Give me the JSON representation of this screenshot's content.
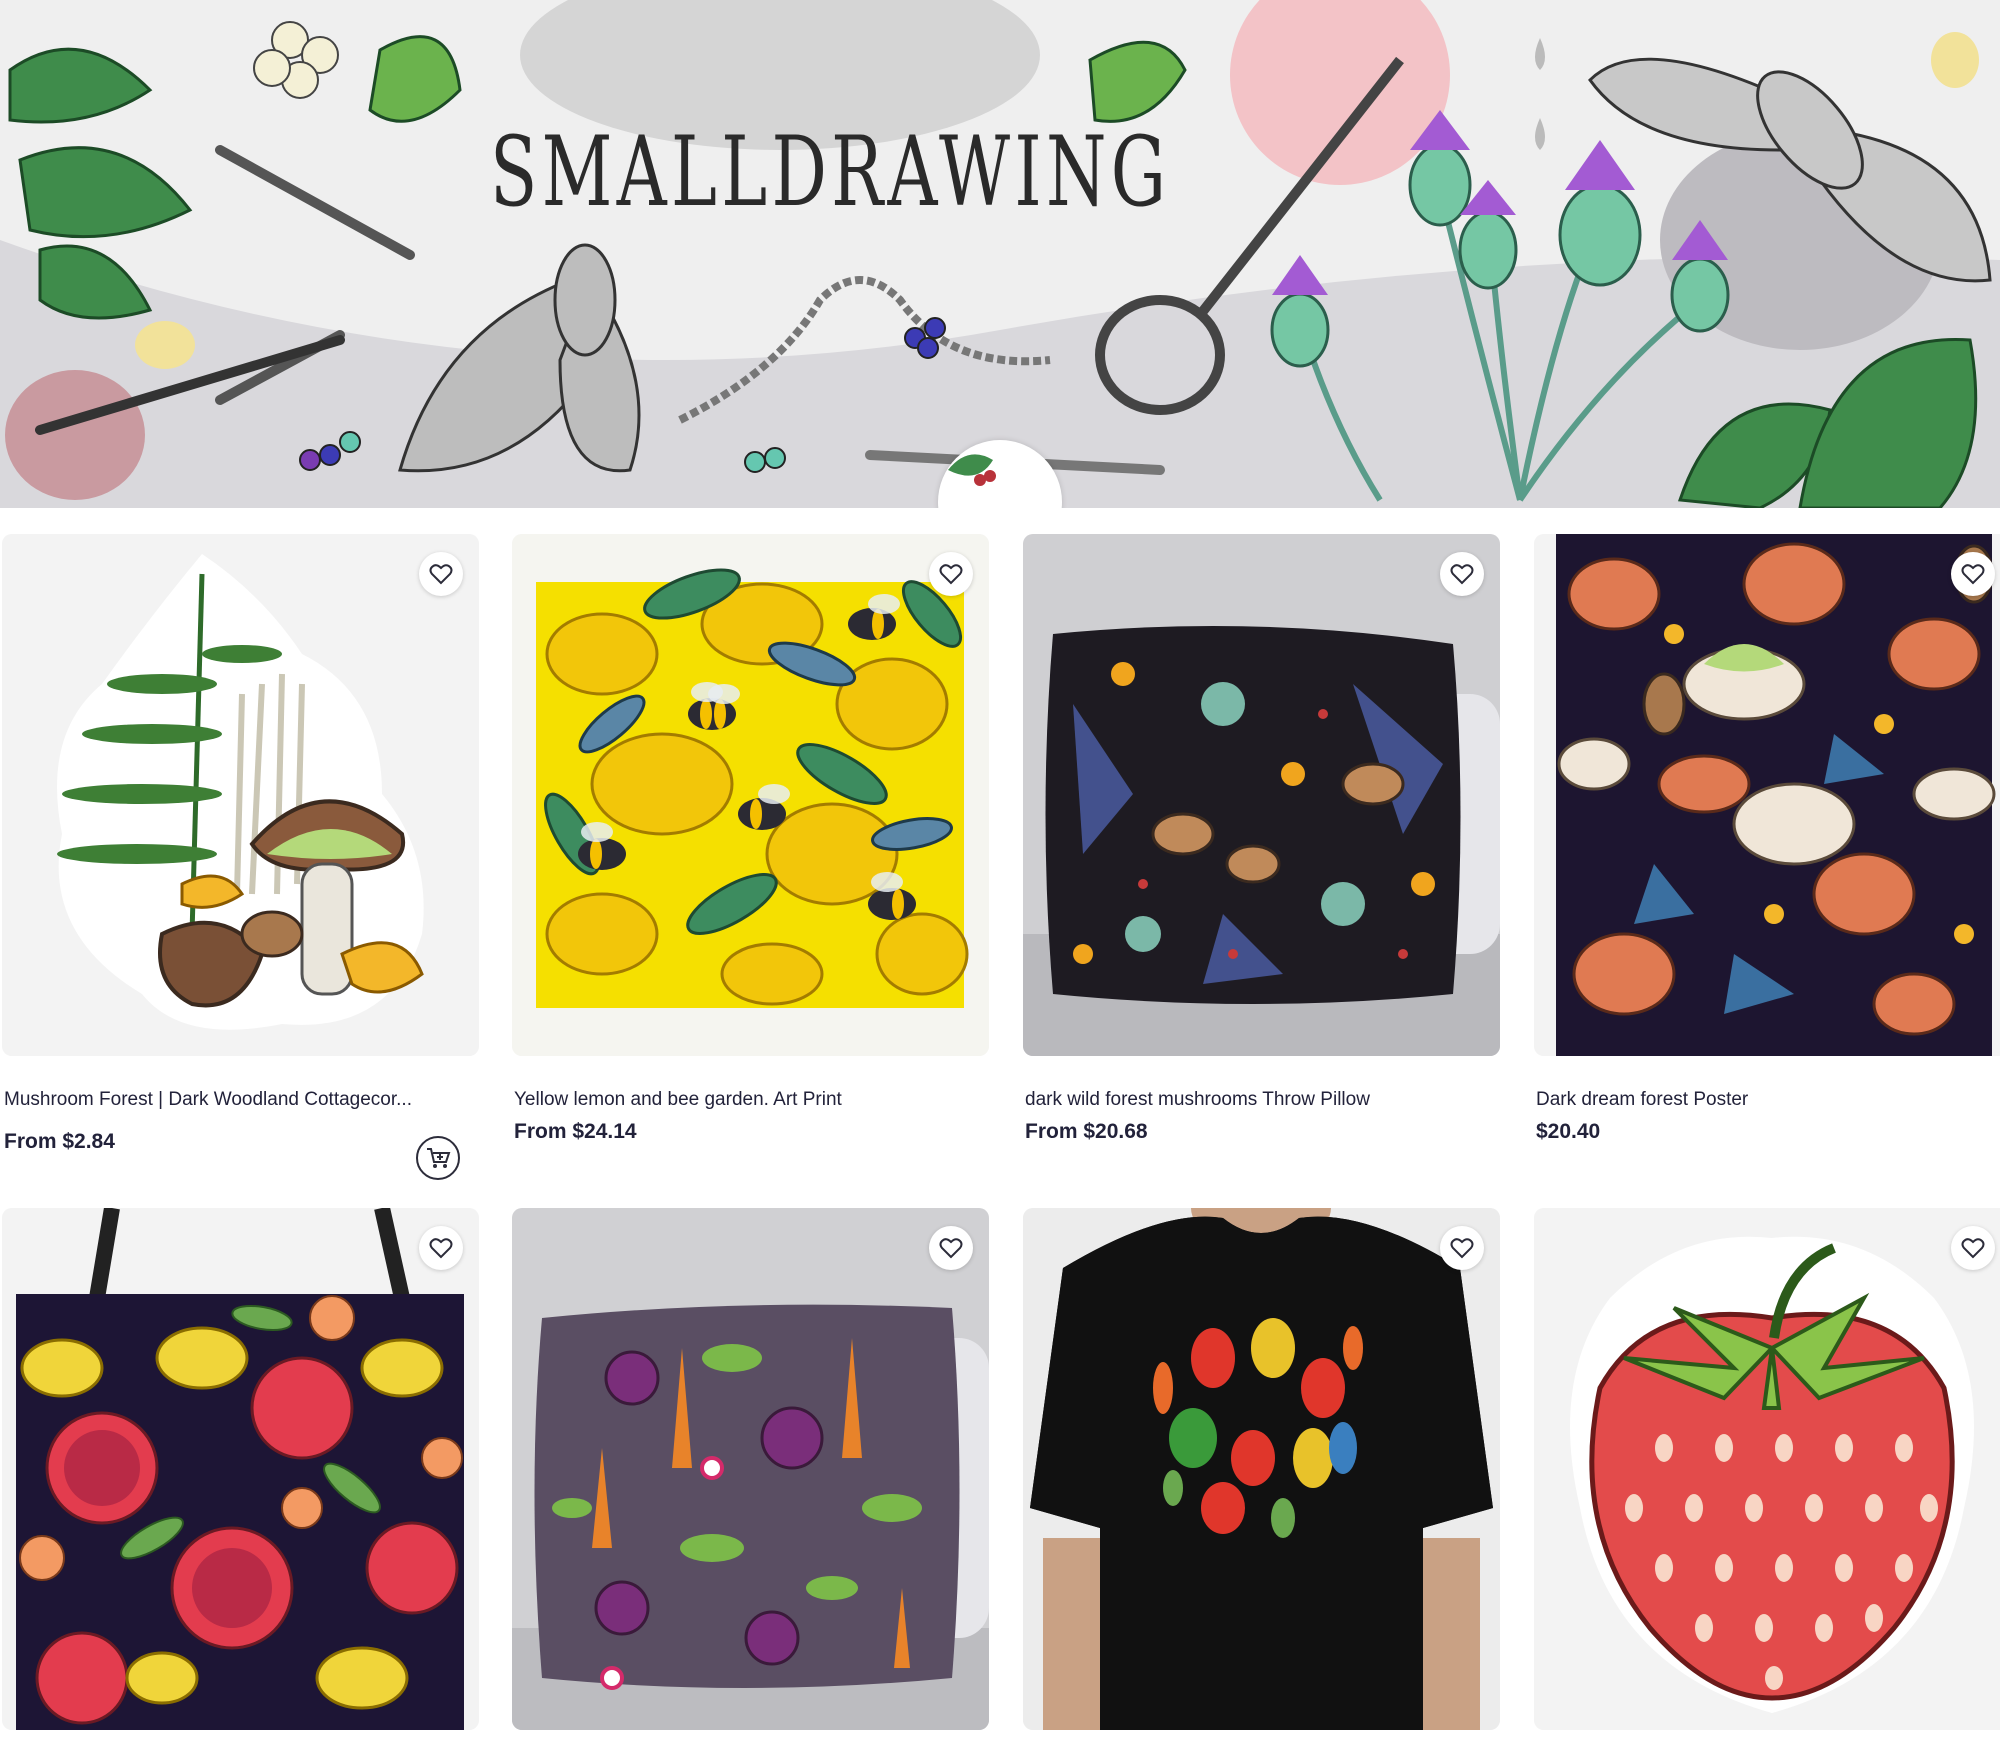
{
  "banner": {
    "shop_name": "SMALLDRAWING"
  },
  "icons": {
    "favorite": "heart-outline-icon",
    "cart": "add-to-cart-icon"
  },
  "products": [
    {
      "title": "Mushroom Forest | Dark Woodland Cottagecor...",
      "price": "From $2.84",
      "type": "sticker"
    },
    {
      "title": "Yellow lemon and bee garden. Art Print",
      "price": "From $24.14",
      "type": "art-print"
    },
    {
      "title": "dark wild forest mushrooms Throw Pillow",
      "price": "From $20.68",
      "type": "throw-pillow"
    },
    {
      "title": "Dark dream forest Poster",
      "price": "$20.40",
      "type": "poster"
    },
    {
      "title": "",
      "price": "",
      "type": "tote-bag"
    },
    {
      "title": "",
      "price": "",
      "type": "throw-pillow"
    },
    {
      "title": "",
      "price": "",
      "type": "t-shirt"
    },
    {
      "title": "",
      "price": "",
      "type": "sticker"
    }
  ],
  "colors": {
    "text": "#22223a",
    "lemon_yellow": "#f5e000",
    "dark_navy": "#1d1530",
    "pink_accent": "#f3c3c7"
  }
}
